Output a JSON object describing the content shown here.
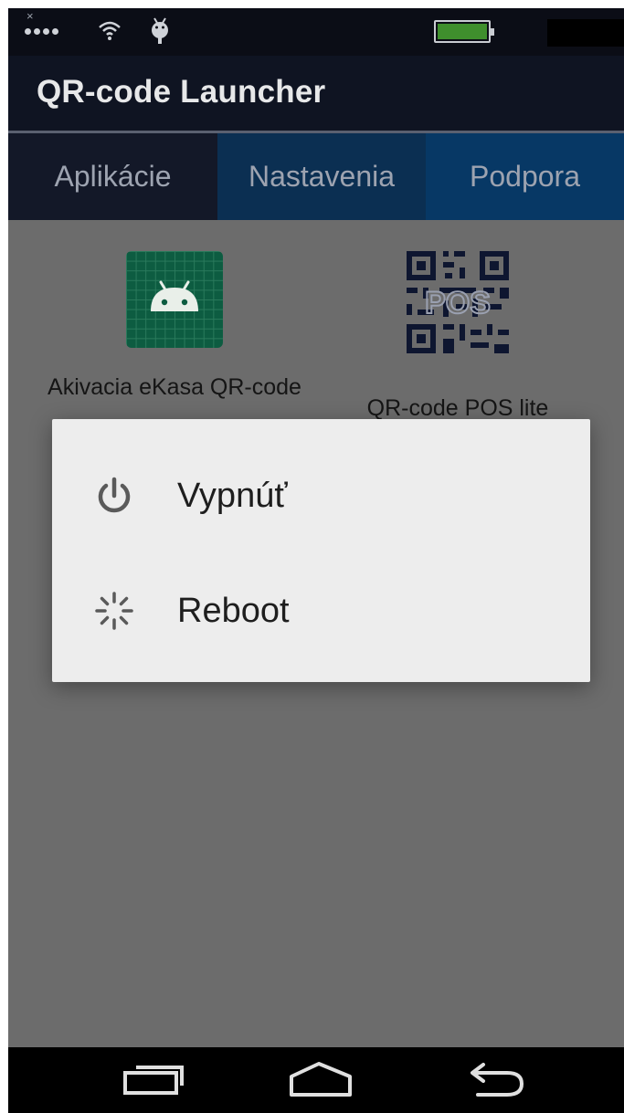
{
  "status_bar": {
    "signal_icon": "cellular-signal-icon",
    "wifi_icon": "wifi-icon",
    "debug_icon": "android-debug-icon",
    "battery_icon": "battery-icon",
    "battery_color": "#3f8f2d"
  },
  "action_bar": {
    "title": "QR-code Launcher"
  },
  "tabs": [
    {
      "label": "Aplikácie"
    },
    {
      "label": "Nastavenia"
    },
    {
      "label": "Podpora"
    }
  ],
  "apps": [
    {
      "label": "Akivacia eKasa QR-code",
      "icon": "android-app-icon"
    },
    {
      "label": "QR-code POS lite",
      "icon": "qr-pos-icon"
    }
  ],
  "power_dialog": {
    "items": [
      {
        "label": "Vypnúť",
        "icon": "power-icon"
      },
      {
        "label": "Reboot",
        "icon": "reboot-spinner-icon"
      }
    ]
  },
  "nav_bar": {
    "recent_icon": "recent-apps-icon",
    "home_icon": "home-icon",
    "back_icon": "back-icon"
  },
  "colors": {
    "tab_active_bg": "#0b2f52",
    "dim_overlay": "#6c6c6c",
    "dialog_bg": "#ededed"
  }
}
